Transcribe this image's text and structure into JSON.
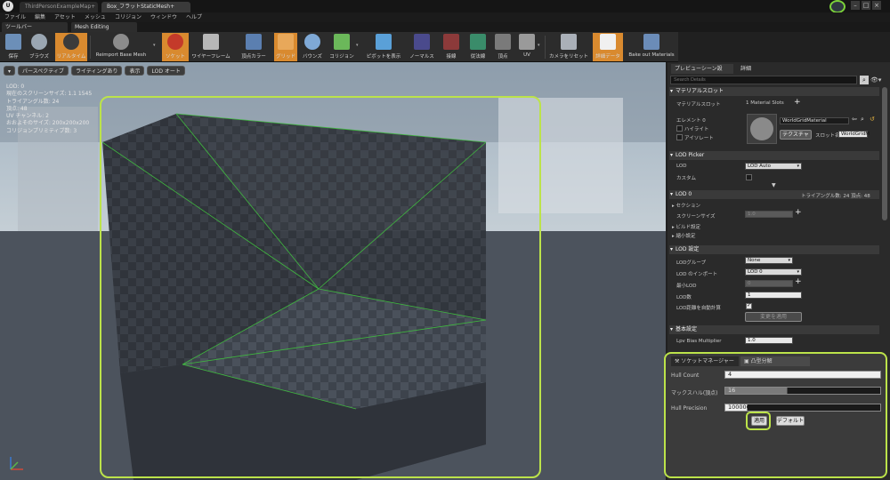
{
  "titlebar": {
    "tabs": [
      {
        "label": "ThirdPersonExampleMap+"
      },
      {
        "label": "Box_フラットStaticMesh+"
      }
    ],
    "window_buttons": [
      "–",
      "□",
      "×"
    ]
  },
  "menu": [
    "ファイル",
    "編集",
    "アセット",
    "メッシュ",
    "コリジョン",
    "ウィンドウ",
    "ヘルプ"
  ],
  "panel_tabs": [
    "ツールバー",
    "Mesh Editing"
  ],
  "toolbar": {
    "buttons": [
      {
        "label": "保存",
        "icon": "save-icon"
      },
      {
        "label": "ブラウズ",
        "icon": "browse-icon"
      },
      {
        "label": "リアルタイム",
        "icon": "realtime-icon"
      },
      {
        "label": "Reimport Base Mesh",
        "icon": "reimport-icon"
      },
      {
        "label": "ソケット",
        "icon": "socket-icon"
      },
      {
        "label": "ワイヤーフレーム",
        "icon": "wireframe-icon"
      },
      {
        "label": "頂点カラー",
        "icon": "vertex-color-icon"
      },
      {
        "label": "グリッド",
        "icon": "grid-icon"
      },
      {
        "label": "バウンズ",
        "icon": "bounds-icon"
      },
      {
        "label": "コリジョン",
        "icon": "collision-icon"
      },
      {
        "label": "ピボットを表示",
        "icon": "pivot-icon"
      },
      {
        "label": "ノーマルス",
        "icon": "normals-icon"
      },
      {
        "label": "接線",
        "icon": "tangents-icon"
      },
      {
        "label": "従法線",
        "icon": "binormals-icon"
      },
      {
        "label": "頂点",
        "icon": "vertices-icon"
      },
      {
        "label": "UV",
        "icon": "uv-icon"
      },
      {
        "label": "カメラをリセット",
        "icon": "reset-camera-icon"
      },
      {
        "label": "詳細データ",
        "icon": "details-icon"
      },
      {
        "label": "Bake out Materials",
        "icon": "bake-icon"
      }
    ]
  },
  "viewport": {
    "buttons": [
      "パースペクティブ",
      "ライティングあり",
      "表示",
      "LOD オート"
    ],
    "stats": [
      "LOD: 0",
      "現在のスクリーンサイズ: 1.1 1545",
      "トライアングル数: 24",
      "頂点: 48",
      "UV チャンネル: 2",
      "おおよそのサイズ: 200x200x200",
      "コリジョンプリミティブ数: 3"
    ]
  },
  "details": {
    "tabs": [
      "プレビューシーン設",
      "詳細"
    ],
    "search_placeholder": "Search Details",
    "material_slots": {
      "header": "マテリアルスロット",
      "label": "マテリアルスロット",
      "count": "1 Material Slots",
      "element_label": "エレメント 0",
      "highlight": "ハイライト",
      "isolate": "アイソレート",
      "material_name": "WorldGridMaterial",
      "texture_btn": "テクスチャ",
      "slot_name_label": "スロット名",
      "slot_name": "WorldGridM"
    },
    "lod_picker": {
      "header": "LOD Picker",
      "lod_label": "LOD",
      "lod_value": "LOD Auto",
      "custom_label": "カスタム"
    },
    "lod0": {
      "header": "LOD 0",
      "stats": "トライアングル数: 24  頂点: 48",
      "section": "セクション",
      "screen_size_label": "スクリーンサイズ",
      "screen_size": "1.0",
      "build": "ビルド設定",
      "reduce": "縮小設定"
    },
    "lod_settings": {
      "header": "LOD 設定",
      "group_label": "LODグループ",
      "group_value": "None",
      "import_label": "LOD のインポート",
      "import_value": "LOD 0",
      "min_lod_label": "最小LOD",
      "min_lod": "0",
      "count_label": "LOD数",
      "count": "1",
      "auto_label": "LOD距離を自動計算",
      "apply_changes": "変更を適用"
    },
    "basic": {
      "header": "基本設定",
      "lpv_label": "Lpv Bias Multiplier",
      "lpv_value": "1.0"
    }
  },
  "decomp": {
    "tabs": [
      "ソケットマネージャー",
      "凸型分解"
    ],
    "hull_count_label": "Hull Count",
    "hull_count": "4",
    "max_hull_label": "マックスハル(頂点)",
    "max_hull": "16",
    "precision_label": "Hull Precision",
    "precision": "100000",
    "apply": "適用",
    "default": "デフォルト"
  },
  "colors": {
    "highlight": "#bce34a",
    "active_orange": "#d98a2f",
    "bg_dark": "#202020"
  }
}
